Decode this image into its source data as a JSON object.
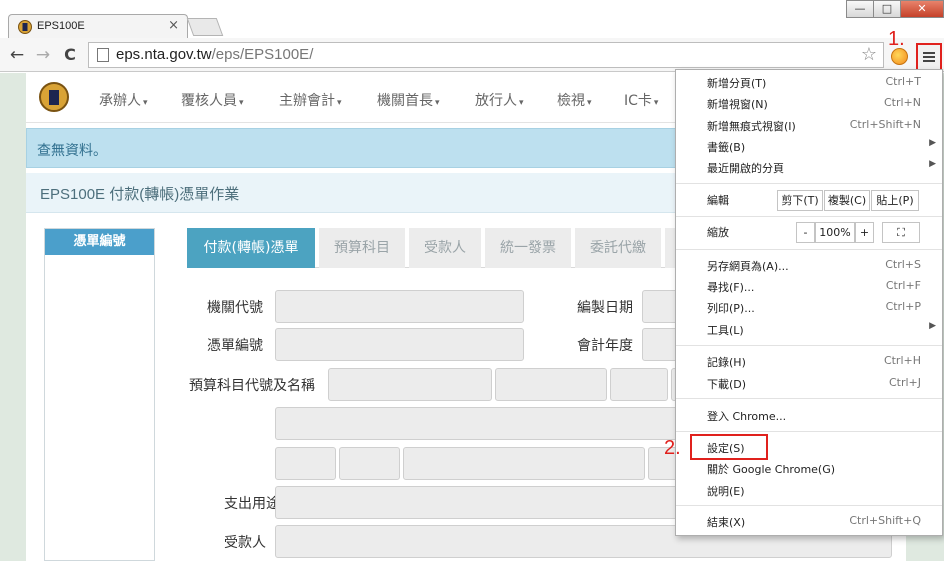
{
  "browser": {
    "tab_title": "EPS100E",
    "tab_close": "×",
    "url_domain": "eps.nta.gov.tw",
    "url_path": "/eps/EPS100E/",
    "window_minimize": "—",
    "window_maximize": "□",
    "window_close": "✕",
    "back": "←",
    "forward": "→",
    "reload": "C",
    "star": "☆"
  },
  "nav": {
    "items": [
      "承辦人",
      "覆核人員",
      "主辦會計",
      "機關首長",
      "放行人",
      "檢視",
      "IC卡"
    ],
    "caret": "▾"
  },
  "alert": {
    "text": "查無資料。"
  },
  "panel": {
    "title": "EPS100E 付款(轉帳)憑單作業"
  },
  "sidebar": {
    "header": "憑單編號"
  },
  "form_tabs": [
    "付款(轉帳)憑單",
    "預算科目",
    "受款人",
    "統一發票",
    "委託代繳"
  ],
  "form": {
    "agency_code": "機關代號",
    "voucher_no": "憑單編號",
    "budget_item": "預算科目代號及名稱",
    "expense_purpose": "支出用途",
    "payee": "受款人",
    "compile_date": "編製日期",
    "fiscal_year": "會計年度"
  },
  "menu": {
    "items": [
      {
        "label": "新增分頁(T)",
        "shortcut": "Ctrl+T"
      },
      {
        "label": "新增視窗(N)",
        "shortcut": "Ctrl+N"
      },
      {
        "label": "新增無痕式視窗(I)",
        "shortcut": "Ctrl+Shift+N"
      },
      {
        "label": "書籤(B)",
        "shortcut": ""
      },
      {
        "label": "最近開啟的分頁",
        "shortcut": ""
      },
      {
        "label": "編輯",
        "shortcut": ""
      },
      {
        "label": "縮放",
        "shortcut": ""
      },
      {
        "label": "另存網頁為(A)...",
        "shortcut": "Ctrl+S"
      },
      {
        "label": "尋找(F)...",
        "shortcut": "Ctrl+F"
      },
      {
        "label": "列印(P)...",
        "shortcut": "Ctrl+P"
      },
      {
        "label": "工具(L)",
        "shortcut": ""
      },
      {
        "label": "記錄(H)",
        "shortcut": "Ctrl+H"
      },
      {
        "label": "下載(D)",
        "shortcut": "Ctrl+J"
      },
      {
        "label": "登入 Chrome...",
        "shortcut": ""
      },
      {
        "label": "設定(S)",
        "shortcut": ""
      },
      {
        "label": "關於 Google Chrome(G)",
        "shortcut": ""
      },
      {
        "label": "說明(E)",
        "shortcut": ""
      },
      {
        "label": "結束(X)",
        "shortcut": "Ctrl+Shift+Q"
      }
    ],
    "submenu_arrow": "▶",
    "edit_buttons": [
      "剪下(T)",
      "複製(C)",
      "貼上(P)"
    ],
    "zoom_minus": "-",
    "zoom_value": "100%",
    "zoom_plus": "+",
    "fullscreen": "⛶"
  },
  "annotations": {
    "step1": "1.",
    "step2": "2."
  }
}
